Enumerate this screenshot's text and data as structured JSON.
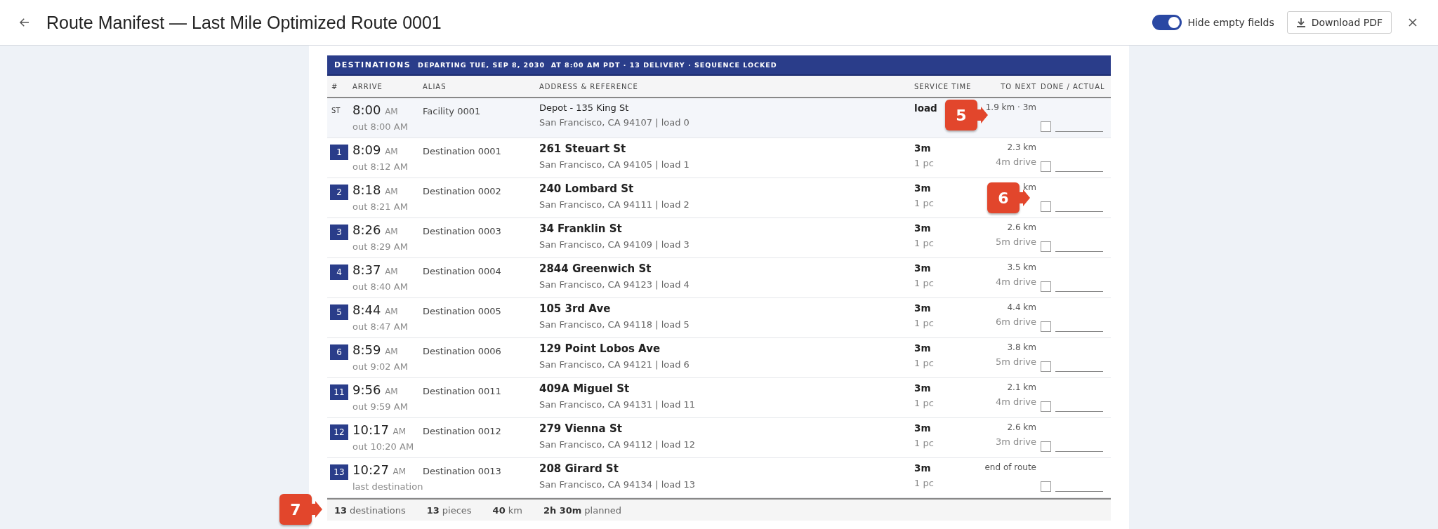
{
  "header": {
    "title": "Route Manifest — Last Mile Optimized Route 0001",
    "toggle": {
      "label": "Hide empty fields",
      "on": true
    },
    "download_button": "Download PDF"
  },
  "banner": {
    "title": "DESTINATIONS",
    "subtitle": "DEPARTING TUE, SEP 8, 2030  AT 8:00 AM PDT · 13 DELIVERY · SEQUENCE LOCKED"
  },
  "table": {
    "columns": [
      "#",
      "ARRIVE",
      "ALIAS",
      "ADDRESS & REFERENCE",
      "SERVICE TIME",
      "TO NEXT",
      "DONE / ACTUAL"
    ],
    "rows": [
      {
        "kind": "start",
        "number": "ST",
        "arrive": "8:00",
        "period": "AM",
        "depart": "out 8:00 AM",
        "alias": "Facility 0001",
        "address": "Depot - 135 King St",
        "reference": "San Francisco, CA 94107 | load 0",
        "service": "load",
        "distance": "1.9 km · 3m",
        "done": false,
        "to_next_callout": "5"
      },
      {
        "kind": "stop",
        "number": "1",
        "arrive": "8:09",
        "period": "AM",
        "depart": "out 8:12 AM",
        "alias": "Destination 0001",
        "address": "261 Steuart St",
        "reference": "San Francisco, CA 94105 | load 1",
        "service": "3m",
        "pieces": "1 pc",
        "distance": "2.3 km",
        "drive": "4m drive",
        "done": false
      },
      {
        "kind": "stop",
        "number": "2",
        "arrive": "8:18",
        "period": "AM",
        "depart": "out 8:21 AM",
        "alias": "Destination 0002",
        "address": "240 Lombard St",
        "reference": "San Francisco, CA 94111 | load 2",
        "service": "3m",
        "pieces": "1 pc",
        "distance": "km",
        "done": false,
        "done_callout": "6"
      },
      {
        "kind": "stop",
        "number": "3",
        "arrive": "8:26",
        "period": "AM",
        "depart": "out 8:29 AM",
        "alias": "Destination 0003",
        "address": "34 Franklin St",
        "reference": "San Francisco, CA 94109 | load 3",
        "service": "3m",
        "pieces": "1 pc",
        "distance": "2.6 km",
        "drive": "5m drive",
        "done": false
      },
      {
        "kind": "stop",
        "number": "4",
        "arrive": "8:37",
        "period": "AM",
        "depart": "out 8:40 AM",
        "alias": "Destination 0004",
        "address": "2844 Greenwich St",
        "reference": "San Francisco, CA 94123 | load 4",
        "service": "3m",
        "pieces": "1 pc",
        "distance": "3.5 km",
        "drive": "4m drive",
        "done": false
      },
      {
        "kind": "stop",
        "number": "5",
        "arrive": "8:44",
        "period": "AM",
        "depart": "out 8:47 AM",
        "alias": "Destination 0005",
        "address": "105 3rd Ave",
        "reference": "San Francisco, CA 94118 | load 5",
        "service": "3m",
        "pieces": "1 pc",
        "distance": "4.4 km",
        "drive": "6m drive",
        "done": false
      },
      {
        "kind": "stop",
        "number": "6",
        "arrive": "8:59",
        "period": "AM",
        "depart": "out 9:02 AM",
        "alias": "Destination 0006",
        "address": "129 Point Lobos Ave",
        "reference": "San Francisco, CA 94121 | load 6",
        "service": "3m",
        "pieces": "1 pc",
        "distance": "3.8 km",
        "drive": "5m drive",
        "done": false
      },
      {
        "kind": "stop",
        "number": "11",
        "arrive": "9:56",
        "period": "AM",
        "depart": "out 9:59 AM",
        "alias": "Destination 0011",
        "address": "409A Miguel St",
        "reference": "San Francisco, CA 94131 | load 11",
        "service": "3m",
        "pieces": "1 pc",
        "distance": "2.1 km",
        "drive": "4m drive",
        "done": false
      },
      {
        "kind": "stop",
        "number": "12",
        "arrive": "10:17",
        "period": "AM",
        "depart": "out 10:20 AM",
        "alias": "Destination 0012",
        "address": "279 Vienna St",
        "reference": "San Francisco, CA 94112 | load 12",
        "service": "3m",
        "pieces": "1 pc",
        "distance": "2.6 km",
        "drive": "3m drive",
        "done": false
      },
      {
        "kind": "stop",
        "number": "13",
        "arrive": "10:27",
        "period": "AM",
        "depart": "last destination",
        "alias": "Destination 0013",
        "address": "208 Girard St",
        "reference": "San Francisco, CA 94134 | load 13",
        "service": "3m",
        "pieces": "1 pc",
        "distance": "end of route",
        "done": false
      }
    ]
  },
  "summary": {
    "callout": "7",
    "items": [
      {
        "value": "13",
        "label": "destinations"
      },
      {
        "value": "13",
        "label": "pieces"
      },
      {
        "value": "40",
        "label": "km"
      },
      {
        "value": "2h 30m",
        "label": "planned"
      }
    ]
  }
}
